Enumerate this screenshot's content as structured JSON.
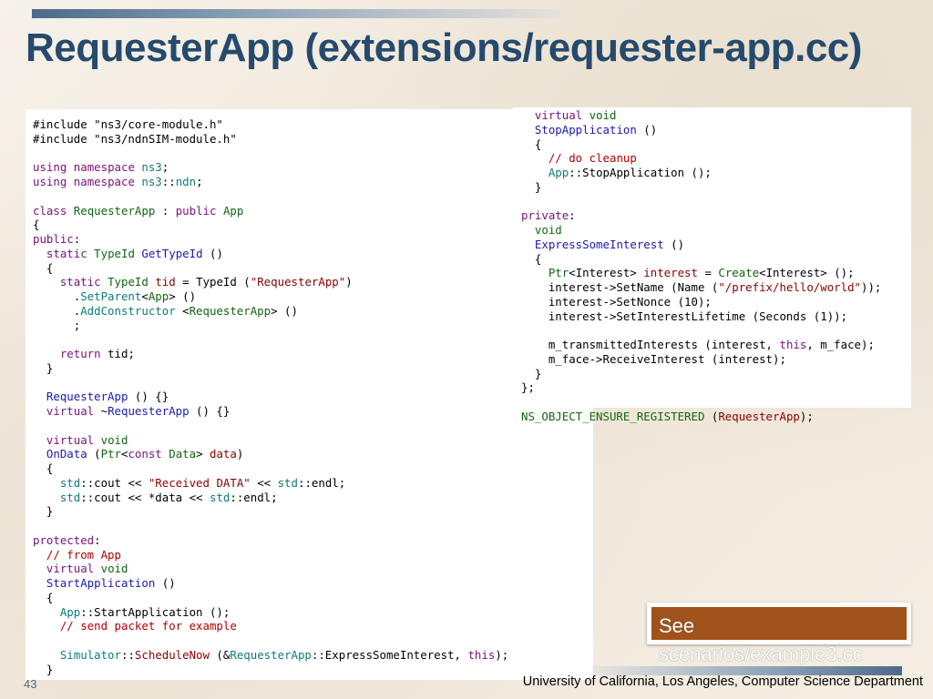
{
  "slide": {
    "title": "RequesterApp (extensions/requester-app.cc)",
    "page_number": "43",
    "footer": "University of California, Los Angeles, Computer Science Department",
    "see_label": "See",
    "see_path": "scenarios/example3.cc"
  },
  "code_left": [
    [
      [
        "pp",
        "#include \"ns3/core-module.h\""
      ]
    ],
    [
      [
        "pp",
        "#include \"ns3/ndnSIM-module.h\""
      ]
    ],
    [],
    [
      [
        "kw",
        "using"
      ],
      [
        "",
        " "
      ],
      [
        "kw",
        "namespace"
      ],
      [
        "",
        " "
      ],
      [
        "ns",
        "ns3"
      ],
      [
        "",
        ";"
      ]
    ],
    [
      [
        "kw",
        "using"
      ],
      [
        "",
        " "
      ],
      [
        "kw",
        "namespace"
      ],
      [
        "",
        " "
      ],
      [
        "ns",
        "ns3"
      ],
      [
        "",
        "::"
      ],
      [
        "ns",
        "ndn"
      ],
      [
        "",
        ";"
      ]
    ],
    [],
    [
      [
        "kw",
        "class"
      ],
      [
        "",
        " "
      ],
      [
        "ty",
        "RequesterApp"
      ],
      [
        "",
        " : "
      ],
      [
        "kw",
        "public"
      ],
      [
        "",
        " "
      ],
      [
        "ty",
        "App"
      ]
    ],
    [
      [
        "",
        "{"
      ]
    ],
    [
      [
        "kw",
        "public"
      ],
      [
        "",
        ":"
      ]
    ],
    [
      [
        "",
        "  "
      ],
      [
        "kw",
        "static"
      ],
      [
        "",
        " "
      ],
      [
        "ty",
        "TypeId"
      ],
      [
        "",
        " "
      ],
      [
        "fn",
        "GetTypeId"
      ],
      [
        "",
        " ()"
      ]
    ],
    [
      [
        "",
        "  {"
      ]
    ],
    [
      [
        "",
        "    "
      ],
      [
        "kw",
        "static"
      ],
      [
        "",
        " "
      ],
      [
        "ty",
        "TypeId"
      ],
      [
        "",
        " "
      ],
      [
        "str",
        "tid"
      ],
      [
        "",
        " = TypeId ("
      ],
      [
        "str",
        "\"RequesterApp\""
      ],
      [
        "",
        ")"
      ]
    ],
    [
      [
        "",
        "      ."
      ],
      [
        "ns",
        "SetParent"
      ],
      [
        "",
        "<"
      ],
      [
        "ty",
        "App"
      ],
      [
        "",
        "> ()"
      ]
    ],
    [
      [
        "",
        "      ."
      ],
      [
        "ns",
        "AddConstructor"
      ],
      [
        "",
        " <"
      ],
      [
        "ty",
        "RequesterApp"
      ],
      [
        "",
        "> ()"
      ]
    ],
    [
      [
        "",
        "      ;"
      ]
    ],
    [],
    [
      [
        "",
        "    "
      ],
      [
        "kw",
        "return"
      ],
      [
        "",
        " tid;"
      ]
    ],
    [
      [
        "",
        "  }"
      ]
    ],
    [],
    [
      [
        "",
        "  "
      ],
      [
        "fn",
        "RequesterApp"
      ],
      [
        "",
        " () {}"
      ]
    ],
    [
      [
        "",
        "  "
      ],
      [
        "kw",
        "virtual"
      ],
      [
        "",
        " ~"
      ],
      [
        "fn",
        "RequesterApp"
      ],
      [
        "",
        " () {}"
      ]
    ],
    [],
    [
      [
        "",
        "  "
      ],
      [
        "kw",
        "virtual"
      ],
      [
        "",
        " "
      ],
      [
        "ty",
        "void"
      ]
    ],
    [
      [
        "",
        "  "
      ],
      [
        "fn",
        "OnData"
      ],
      [
        "",
        " ("
      ],
      [
        "ty",
        "Ptr"
      ],
      [
        "",
        "<"
      ],
      [
        "kw",
        "const"
      ],
      [
        "",
        " "
      ],
      [
        "ty",
        "Data"
      ],
      [
        "",
        "> "
      ],
      [
        "str",
        "data"
      ],
      [
        "",
        ")"
      ]
    ],
    [
      [
        "",
        "  {"
      ]
    ],
    [
      [
        "",
        "    "
      ],
      [
        "ns",
        "std"
      ],
      [
        "",
        "::cout << "
      ],
      [
        "str",
        "\"Received DATA\""
      ],
      [
        "",
        " << "
      ],
      [
        "ns",
        "std"
      ],
      [
        "",
        "::endl;"
      ]
    ],
    [
      [
        "",
        "    "
      ],
      [
        "ns",
        "std"
      ],
      [
        "",
        "::cout << *data << "
      ],
      [
        "ns",
        "std"
      ],
      [
        "",
        "::endl;"
      ]
    ],
    [
      [
        "",
        "  }"
      ]
    ],
    [],
    [
      [
        "kw",
        "protected"
      ],
      [
        "",
        ":"
      ]
    ],
    [
      [
        "",
        "  "
      ],
      [
        "cm",
        "// from App"
      ]
    ],
    [
      [
        "",
        "  "
      ],
      [
        "kw",
        "virtual"
      ],
      [
        "",
        " "
      ],
      [
        "ty",
        "void"
      ]
    ],
    [
      [
        "",
        "  "
      ],
      [
        "fn",
        "StartApplication"
      ],
      [
        "",
        " ()"
      ]
    ],
    [
      [
        "",
        "  {"
      ]
    ],
    [
      [
        "",
        "    "
      ],
      [
        "ns",
        "App"
      ],
      [
        "",
        "::StartApplication ();"
      ]
    ],
    [
      [
        "",
        "    "
      ],
      [
        "cm",
        "// send packet for example"
      ]
    ],
    [],
    [
      [
        "",
        "    "
      ],
      [
        "ns",
        "Simulator"
      ],
      [
        "",
        "::"
      ],
      [
        "str",
        "ScheduleNow"
      ],
      [
        "",
        " (&"
      ],
      [
        "ns",
        "RequesterApp"
      ],
      [
        "",
        "::ExpressSomeInterest, "
      ],
      [
        "kw",
        "this"
      ],
      [
        "",
        ");"
      ]
    ],
    [
      [
        "",
        "  }"
      ]
    ]
  ],
  "code_right": [
    [
      [
        "",
        "  "
      ],
      [
        "kw",
        "virtual"
      ],
      [
        "",
        " "
      ],
      [
        "ty",
        "void"
      ]
    ],
    [
      [
        "",
        "  "
      ],
      [
        "fn",
        "StopApplication"
      ],
      [
        "",
        " ()"
      ]
    ],
    [
      [
        "",
        "  {"
      ]
    ],
    [
      [
        "",
        "    "
      ],
      [
        "cm",
        "// do cleanup"
      ]
    ],
    [
      [
        "",
        "    "
      ],
      [
        "ns",
        "App"
      ],
      [
        "",
        "::StopApplication ();"
      ]
    ],
    [
      [
        "",
        "  }"
      ]
    ],
    [],
    [
      [
        "kw",
        "private"
      ],
      [
        "",
        ":"
      ]
    ],
    [
      [
        "",
        "  "
      ],
      [
        "ty",
        "void"
      ]
    ],
    [
      [
        "",
        "  "
      ],
      [
        "fn",
        "ExpressSomeInterest"
      ],
      [
        "",
        " ()"
      ]
    ],
    [
      [
        "",
        "  {"
      ]
    ],
    [
      [
        "",
        "    "
      ],
      [
        "ty",
        "Ptr"
      ],
      [
        "",
        "<Interest> "
      ],
      [
        "str",
        "interest"
      ],
      [
        "",
        " = "
      ],
      [
        "ty",
        "Create"
      ],
      [
        "",
        "<Interest> ();"
      ]
    ],
    [
      [
        "",
        "    interest->SetName (Name ("
      ],
      [
        "str",
        "\"/prefix/hello/world\""
      ],
      [
        "",
        "));"
      ]
    ],
    [
      [
        "",
        "    interest->SetNonce (10);"
      ]
    ],
    [
      [
        "",
        "    interest->SetInterestLifetime (Seconds (1));"
      ]
    ],
    [],
    [
      [
        "",
        "    m_transmittedInterests (interest, "
      ],
      [
        "kw",
        "this"
      ],
      [
        "",
        ", m_face);"
      ]
    ],
    [
      [
        "",
        "    m_face->ReceiveInterest (interest);"
      ]
    ],
    [
      [
        "",
        "  }"
      ]
    ],
    [
      [
        "",
        "};"
      ]
    ],
    [],
    [
      [
        "ty",
        "NS_OBJECT_ENSURE_REGISTERED"
      ],
      [
        "",
        " ("
      ],
      [
        "str",
        "RequesterApp"
      ],
      [
        "",
        ");"
      ]
    ]
  ],
  "colors": {
    "title": "#254a6d",
    "keyword": "#7a117a",
    "type": "#116611",
    "function": "#1a1ab0",
    "string": "#8b0000",
    "comment": "#b00000",
    "namespace": "#0f7a7a",
    "see_box": "#a1521a"
  }
}
